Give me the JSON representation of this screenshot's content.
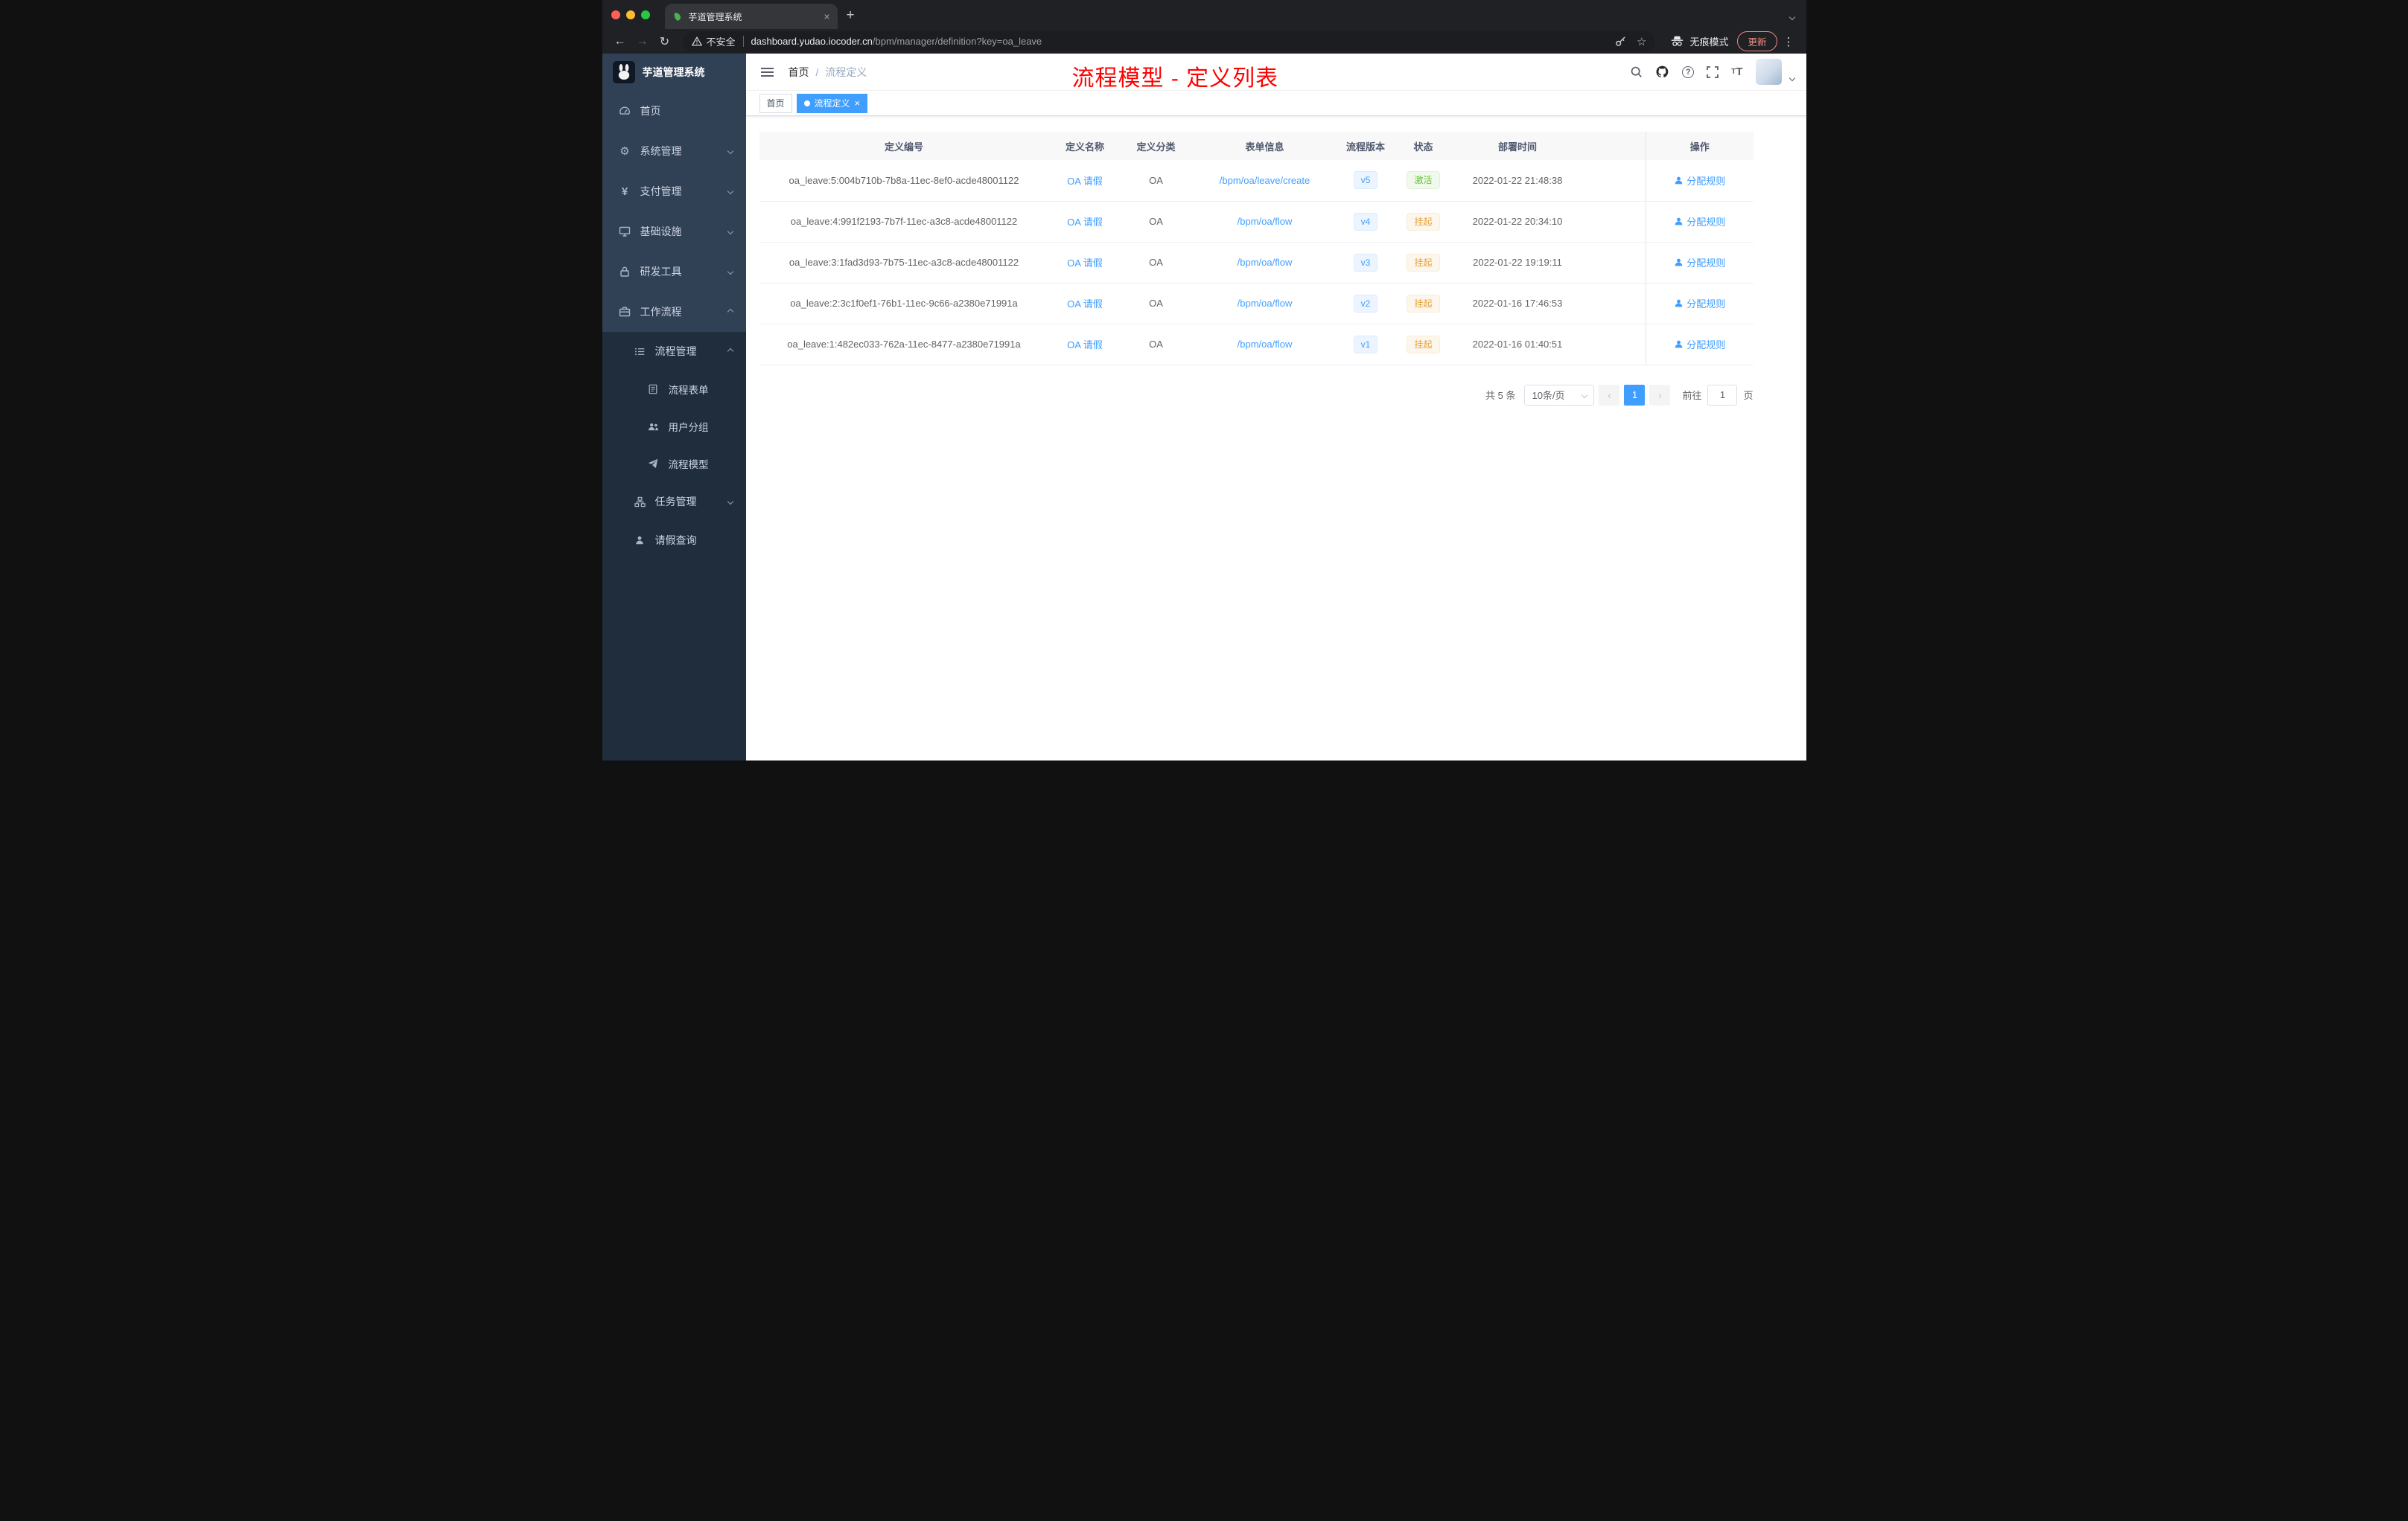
{
  "browser": {
    "tab": {
      "title": "芋道管理系统"
    },
    "address": {
      "security_label": "不安全",
      "url_host": "dashboard.yudao.iocoder.cn",
      "url_path": "/bpm/manager/definition?key=oa_leave",
      "incognito_label": "无痕模式",
      "update_label": "更新"
    }
  },
  "sidebar": {
    "logo_title": "芋道管理系统",
    "items": [
      {
        "label": "首页",
        "icon": "dashboard-icon"
      },
      {
        "label": "系统管理",
        "icon": "gear-icon"
      },
      {
        "label": "支付管理",
        "icon": "yen-icon"
      },
      {
        "label": "基础设施",
        "icon": "infrastructure-icon"
      },
      {
        "label": "研发工具",
        "icon": "tool-icon"
      },
      {
        "label": "工作流程",
        "icon": "workflow-icon"
      },
      {
        "label": "流程管理",
        "icon": "process-list-icon"
      },
      {
        "label": "流程表单",
        "icon": "form-icon"
      },
      {
        "label": "用户分组",
        "icon": "user-group-icon"
      },
      {
        "label": "流程模型",
        "icon": "paper-plane-icon"
      },
      {
        "label": "任务管理",
        "icon": "task-tree-icon"
      },
      {
        "label": "请假查询",
        "icon": "user-icon"
      }
    ]
  },
  "header": {
    "breadcrumb": {
      "home": "首页",
      "separator": "/",
      "current": "流程定义"
    },
    "annotation": "流程模型 - 定义列表"
  },
  "tags": [
    {
      "label": "首页"
    },
    {
      "label": "流程定义"
    }
  ],
  "table": {
    "columns": [
      "定义编号",
      "定义名称",
      "定义分类",
      "表单信息",
      "流程版本",
      "状态",
      "部署时间",
      "操作"
    ],
    "rows": [
      {
        "id": "oa_leave:5:004b710b-7b8a-11ec-8ef0-acde48001122",
        "name": "OA 请假",
        "category": "OA",
        "form": "/bpm/oa/leave/create",
        "version": "v5",
        "status": "激活",
        "time": "2022-01-22 21:48:38",
        "action": "分配规则"
      },
      {
        "id": "oa_leave:4:991f2193-7b7f-11ec-a3c8-acde48001122",
        "name": "OA 请假",
        "category": "OA",
        "form": "/bpm/oa/flow",
        "version": "v4",
        "status": "挂起",
        "time": "2022-01-22 20:34:10",
        "action": "分配规则"
      },
      {
        "id": "oa_leave:3:1fad3d93-7b75-11ec-a3c8-acde48001122",
        "name": "OA 请假",
        "category": "OA",
        "form": "/bpm/oa/flow",
        "version": "v3",
        "status": "挂起",
        "time": "2022-01-22 19:19:11",
        "action": "分配规则"
      },
      {
        "id": "oa_leave:2:3c1f0ef1-76b1-11ec-9c66-a2380e71991a",
        "name": "OA 请假",
        "category": "OA",
        "form": "/bpm/oa/flow",
        "version": "v2",
        "status": "挂起",
        "time": "2022-01-16 17:46:53",
        "action": "分配规则"
      },
      {
        "id": "oa_leave:1:482ec033-762a-11ec-8477-a2380e71991a",
        "name": "OA 请假",
        "category": "OA",
        "form": "/bpm/oa/flow",
        "version": "v1",
        "status": "挂起",
        "time": "2022-01-16 01:40:51",
        "action": "分配规则"
      }
    ]
  },
  "pagination": {
    "total_label": "共 5 条",
    "page_size": "10条/页",
    "current_page": "1",
    "goto_label": "前往",
    "goto_value": "1",
    "page_unit": "页"
  },
  "colors": {
    "accent": "#409eff",
    "annotation_red": "#ff0000",
    "status_active_green": "#67c23a",
    "status_suspend_orange": "#e6a23c",
    "sidebar_bg": "#304156",
    "submenu_bg": "#1f2d3d"
  }
}
